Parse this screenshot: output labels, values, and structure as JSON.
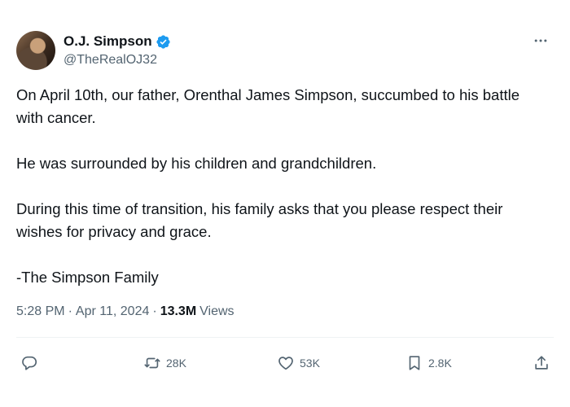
{
  "author": {
    "display_name": "O.J. Simpson",
    "handle": "@TheRealOJ32",
    "verified": true,
    "verified_color": "#1d9bf0"
  },
  "post": {
    "paragraphs": [
      "On April 10th, our father, Orenthal James Simpson, succumbed to his battle with cancer.",
      "He was surrounded by his children and grandchildren.",
      "During this time of transition, his family asks that you please respect their wishes for privacy and grace.",
      "-The Simpson Family"
    ],
    "time": "5:28 PM",
    "date": "Apr 11, 2024",
    "views_count": "13.3M",
    "views_label": "Views",
    "separator": "·"
  },
  "actions": {
    "reply": {
      "icon": "reply-icon",
      "count": ""
    },
    "repost": {
      "icon": "repost-icon",
      "count": "28K"
    },
    "like": {
      "icon": "heart-icon",
      "count": "53K"
    },
    "bookmark": {
      "icon": "bookmark-icon",
      "count": "2.8K"
    },
    "share": {
      "icon": "share-icon",
      "count": ""
    }
  },
  "colors": {
    "text": "#0f1419",
    "secondary": "#536471",
    "divider": "#eff3f4"
  }
}
